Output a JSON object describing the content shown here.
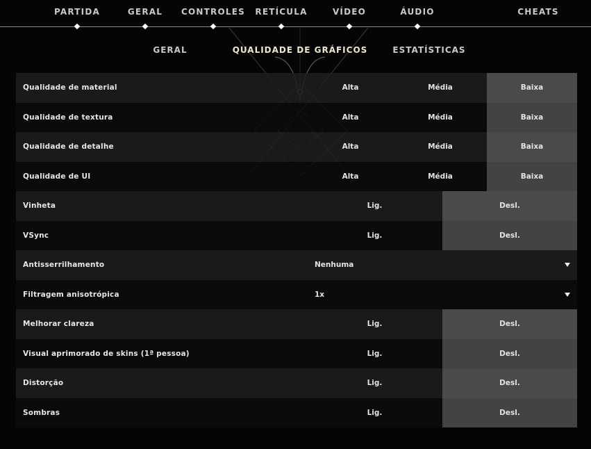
{
  "top_nav": {
    "tabs": [
      {
        "label": "PARTIDA",
        "has_dot": true
      },
      {
        "label": "GERAL",
        "has_dot": true
      },
      {
        "label": "CONTROLES",
        "has_dot": true
      },
      {
        "label": "RETÍCULA",
        "has_dot": true
      },
      {
        "label": "VÍDEO",
        "has_dot": true,
        "active": true
      },
      {
        "label": "ÁUDIO",
        "has_dot": true
      },
      {
        "label": "CHEATS",
        "has_dot": false
      }
    ]
  },
  "sub_nav": {
    "tabs": [
      {
        "label": "GERAL"
      },
      {
        "label": "QUALIDADE DE GRÁFICOS",
        "active": true
      },
      {
        "label": "ESTATÍSTICAS"
      }
    ]
  },
  "settings": [
    {
      "label": "Qualidade de material",
      "type": "options",
      "options": [
        "Alta",
        "Média",
        "Baixa"
      ],
      "selected": "Baixa"
    },
    {
      "label": "Qualidade de textura",
      "type": "options",
      "options": [
        "Alta",
        "Média",
        "Baixa"
      ],
      "selected": "Baixa"
    },
    {
      "label": "Qualidade de detalhe",
      "type": "options",
      "options": [
        "Alta",
        "Média",
        "Baixa"
      ],
      "selected": "Baixa"
    },
    {
      "label": "Qualidade de UI",
      "type": "options",
      "options": [
        "Alta",
        "Média",
        "Baixa"
      ],
      "selected": "Baixa"
    },
    {
      "label": "Vinheta",
      "type": "options",
      "options": [
        "Lig.",
        "Desl."
      ],
      "selected": "Desl."
    },
    {
      "label": "VSync",
      "type": "options",
      "options": [
        "Lig.",
        "Desl."
      ],
      "selected": "Desl."
    },
    {
      "label": "Antisserrilhamento",
      "type": "dropdown",
      "value": "Nenhuma"
    },
    {
      "label": "Filtragem anisotrópica",
      "type": "dropdown",
      "value": "1x"
    },
    {
      "label": "Melhorar clareza",
      "type": "options",
      "options": [
        "Lig.",
        "Desl."
      ],
      "selected": "Desl."
    },
    {
      "label": "Visual aprimorado de skins (1ª pessoa)",
      "type": "options",
      "options": [
        "Lig.",
        "Desl."
      ],
      "selected": "Desl."
    },
    {
      "label": "Distorção",
      "type": "options",
      "options": [
        "Lig.",
        "Desl."
      ],
      "selected": "Desl."
    },
    {
      "label": "Sombras",
      "type": "options",
      "options": [
        "Lig.",
        "Desl."
      ],
      "selected": "Desl."
    }
  ],
  "colors": {
    "selected_option_bg": "#4a4a4a",
    "active_subtab": "#ece8c8",
    "text": "#e6e6e6"
  }
}
